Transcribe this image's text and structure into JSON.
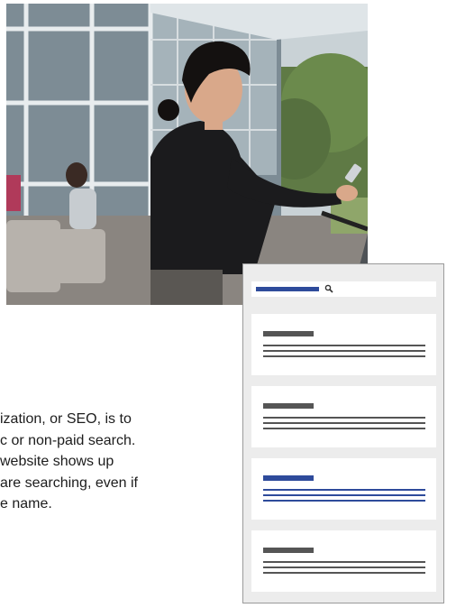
{
  "photo": {
    "alt_subject": "woman-on-balcony-using-phone"
  },
  "body": {
    "lines": [
      "ization, or SEO, is to",
      "c or non-paid search.",
      "website shows up",
      "are searching, even if",
      "e name."
    ]
  },
  "search_mockup": {
    "results": [
      {
        "style": "gray"
      },
      {
        "style": "gray"
      },
      {
        "style": "blue"
      },
      {
        "style": "gray"
      }
    ]
  },
  "colors": {
    "accent_blue": "#2e4b9b",
    "placeholder_gray": "#555555",
    "panel_bg": "#ececec"
  },
  "icons": {
    "search": "search-icon"
  }
}
